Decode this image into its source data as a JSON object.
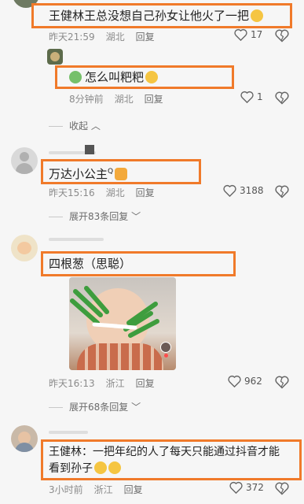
{
  "comments": [
    {
      "text": "王健林王总没想自己孙女让他火了一把",
      "time": "昨天21:59",
      "location": "湖北",
      "reply": "回复",
      "likes": "17",
      "replies": [
        {
          "name": "",
          "text": "怎么叫粑粑",
          "time": "8分钟前",
          "location": "湖北",
          "reply": "回复",
          "likes": "1"
        }
      ],
      "collapse": "收起"
    },
    {
      "text": "万达小公主",
      "time": "昨天15:16",
      "location": "湖北",
      "reply": "回复",
      "likes": "3188",
      "expand": "展开83条回复"
    },
    {
      "text": "四根葱（思聪）",
      "time": "昨天16:13",
      "location": "浙江",
      "reply": "回复",
      "likes": "962",
      "expand": "展开68条回复"
    },
    {
      "text_line1": "王健林：一把年纪的人了每天只能通过抖音才能",
      "text_line2": "看到孙子",
      "time": "3小时前",
      "location": "浙江",
      "reply": "回复",
      "likes": "372"
    }
  ],
  "icons": {
    "like": "heart-outline-icon",
    "dislike": "heart-broken-icon",
    "chevron": "chevron-icon"
  },
  "colors": {
    "highlight": "#f07a2a",
    "meta": "#8b8b8b"
  }
}
